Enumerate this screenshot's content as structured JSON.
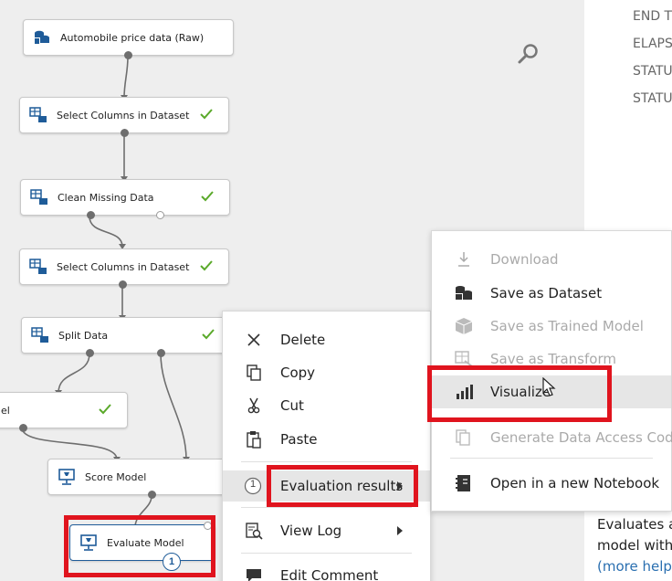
{
  "right_panel": {
    "labels": [
      "END TI",
      "ELAPSI",
      "STATUS",
      "STATUS"
    ],
    "description": {
      "line1": "Evaluates a",
      "line2": "model with",
      "link": "(more help..."
    }
  },
  "canvas": {
    "nodes": [
      {
        "label": "Automobile price data (Raw)",
        "icon": "dataset-icon",
        "checked": false
      },
      {
        "label": "Select Columns in Dataset",
        "icon": "module-icon",
        "checked": true
      },
      {
        "label": "Clean Missing Data",
        "icon": "module-icon",
        "checked": true
      },
      {
        "label": "Select Columns in Dataset",
        "icon": "module-icon",
        "checked": true
      },
      {
        "label": "Split Data",
        "icon": "module-icon",
        "checked": true
      },
      {
        "label": "el",
        "icon": "",
        "checked": true
      },
      {
        "label": "Score Model",
        "icon": "score-icon",
        "checked": false
      },
      {
        "label": "Evaluate Model",
        "icon": "evaluate-icon",
        "checked": false
      }
    ],
    "evaluate_badge": "1"
  },
  "context_menu": {
    "items": [
      {
        "label": "Delete",
        "icon": "delete-x-icon"
      },
      {
        "label": "Copy",
        "icon": "copy-icon"
      },
      {
        "label": "Cut",
        "icon": "scissors-icon"
      },
      {
        "label": "Paste",
        "icon": "paste-icon"
      },
      {
        "label": "Evaluation results",
        "icon": "output-port-1-icon",
        "port_number": "1",
        "has_submenu": true
      },
      {
        "label": "View Log",
        "icon": "view-log-icon",
        "has_submenu": true
      },
      {
        "label": "Edit Comment",
        "icon": "comment-icon"
      }
    ]
  },
  "submenu": {
    "items": [
      {
        "label": "Download",
        "icon": "download-icon",
        "enabled": false
      },
      {
        "label": "Save as Dataset",
        "icon": "dataset-icon",
        "enabled": true
      },
      {
        "label": "Save as Trained Model",
        "icon": "trained-model-icon",
        "enabled": false
      },
      {
        "label": "Save as Transform",
        "icon": "transform-icon",
        "enabled": false
      },
      {
        "label": "Visualize",
        "icon": "bar-chart-icon",
        "enabled": true
      },
      {
        "label": "Generate Data Access Code...",
        "icon": "generate-code-icon",
        "enabled": false
      },
      {
        "label": "Open in a new Notebook",
        "icon": "notebook-icon",
        "enabled": true
      }
    ]
  },
  "colors": {
    "highlight": "#e0141e",
    "check": "#5aa92a",
    "link": "#2a6fb0",
    "badge": "#1f5c99"
  }
}
